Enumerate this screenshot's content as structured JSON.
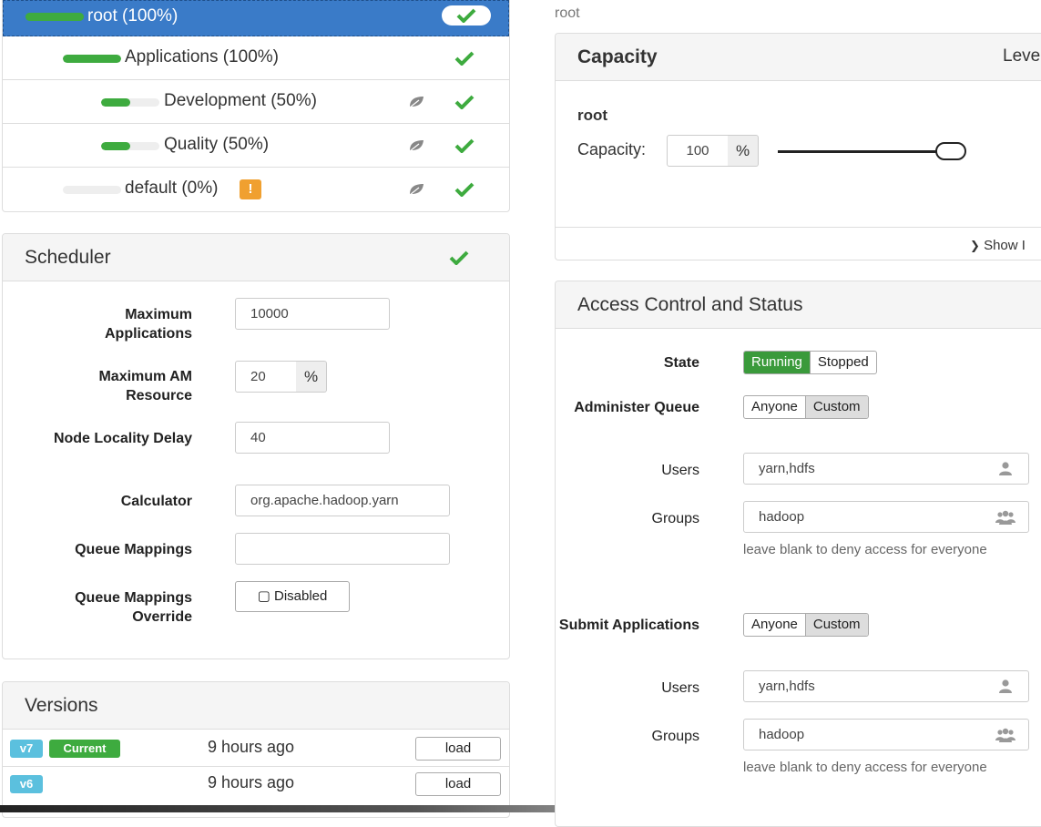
{
  "queues": [
    {
      "label": "root (100%)",
      "fill": 1.0
    },
    {
      "label": "Applications (100%)",
      "fill": 1.0
    },
    {
      "label": "Development (50%)",
      "fill": 0.5
    },
    {
      "label": "Quality (50%)",
      "fill": 0.5
    },
    {
      "label": "default (0%)",
      "fill": 0.0,
      "warning": "!"
    }
  ],
  "scheduler": {
    "title": "Scheduler",
    "max_apps_label": "Maximum Applications",
    "max_apps_value": "10000",
    "max_am_label": "Maximum AM Resource",
    "max_am_value": "20",
    "max_am_unit": "%",
    "node_locality_label": "Node Locality Delay",
    "node_locality_value": "40",
    "calculator_label": "Calculator",
    "calculator_value": "org.apache.hadoop.yarn",
    "queue_mappings_label": "Queue Mappings",
    "queue_mappings_value": "",
    "override_label": "Queue Mappings Override",
    "override_button": "▢ Disabled"
  },
  "versions": {
    "title": "Versions",
    "items": [
      {
        "tag": "v7",
        "current": "Current",
        "time": "9 hours ago",
        "action": "load"
      },
      {
        "tag": "v6",
        "current": "",
        "time": "9 hours ago",
        "action": "load"
      }
    ]
  },
  "breadcrumb": "root",
  "capacity": {
    "title": "Capacity",
    "level_label": "Leve",
    "queue_name": "root",
    "capacity_label": "Capacity:",
    "capacity_value": "100",
    "capacity_unit": "%",
    "capacity_fraction": 1.0,
    "show_more": "Show I"
  },
  "access": {
    "title": "Access Control and Status",
    "state_label": "State",
    "state_options": [
      "Running",
      "Stopped"
    ],
    "state_selected": "Running",
    "administer_label": "Administer Queue",
    "administer_options": [
      "Anyone",
      "Custom"
    ],
    "administer_selected": "Custom",
    "admin_users_label": "Users",
    "admin_users_value": "yarn,hdfs",
    "admin_groups_label": "Groups",
    "admin_groups_value": "hadoop",
    "admin_hint": "leave blank to deny access for everyone",
    "submit_label": "Submit Applications",
    "submit_options": [
      "Anyone",
      "Custom"
    ],
    "submit_selected": "Custom",
    "submit_users_label": "Users",
    "submit_users_value": "yarn,hdfs",
    "submit_groups_label": "Groups",
    "submit_groups_value": "hadoop",
    "submit_hint": "leave blank to deny access for everyone"
  },
  "colors": {
    "accent": "#3a7bc8",
    "success": "#3eab3f",
    "warning": "#f0a030",
    "info": "#5bc0de"
  }
}
